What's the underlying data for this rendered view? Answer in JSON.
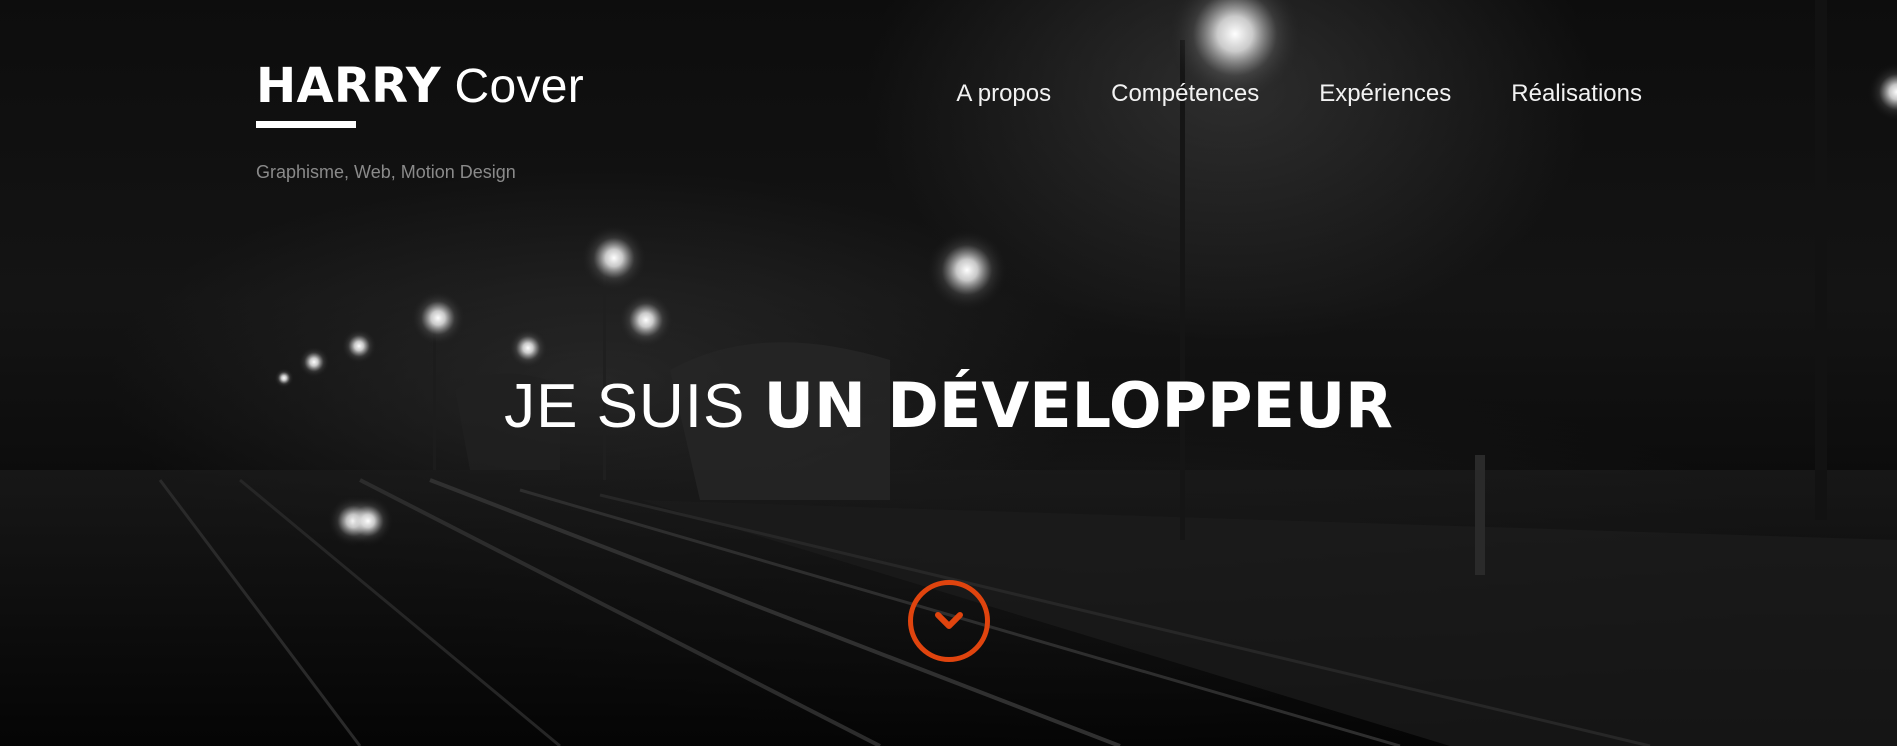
{
  "brand": {
    "title_first": "HARRY",
    "title_last": " Cover",
    "tagline": "Graphisme, Web, Motion Design"
  },
  "nav": {
    "items": [
      {
        "label": "A propos"
      },
      {
        "label": "Compétences"
      },
      {
        "label": "Expériences"
      },
      {
        "label": "Réalisations"
      }
    ]
  },
  "hero": {
    "headline_light": "JE SUIS ",
    "headline_bold": "UN DÉVELOPPEUR",
    "scroll_icon": "chevron-down-circle-icon"
  },
  "colors": {
    "accent": "#e0440e",
    "text": "#ffffff",
    "tagline": "#8a8a8a"
  }
}
